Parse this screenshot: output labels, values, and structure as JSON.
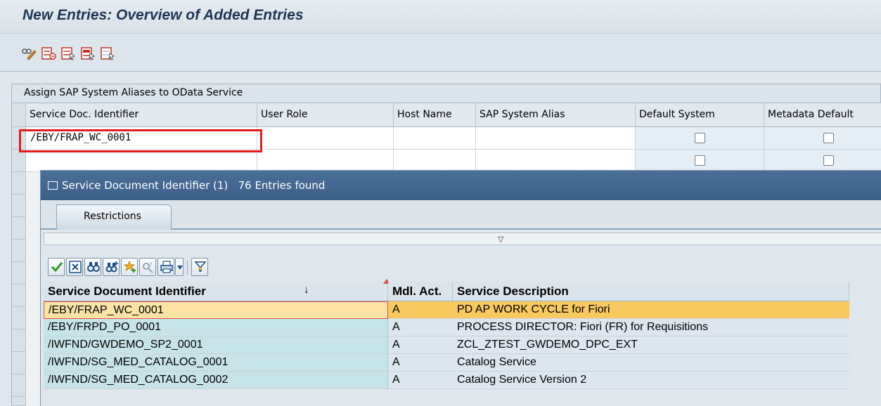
{
  "window": {
    "title": "New Entries: Overview of Added Entries"
  },
  "toolbar": {
    "icons": [
      "display-change-icon",
      "delete-row-icon",
      "select-all-icon",
      "select-block-icon",
      "deselect-all-icon"
    ]
  },
  "table": {
    "caption": "Assign SAP System Aliases to OData Service",
    "columns": [
      "Service Doc. Identifier",
      "User Role",
      "Host Name",
      "SAP System Alias",
      "Default System",
      "Metadata Default"
    ],
    "rows": [
      {
        "service_doc_id": "/EBY/FRAP_WC_0001",
        "user_role": "",
        "host_name": "",
        "system_alias": "",
        "default_system": false,
        "metadata_default": false
      },
      {
        "service_doc_id": "",
        "user_role": "",
        "host_name": "",
        "system_alias": "",
        "default_system": false,
        "metadata_default": false
      }
    ]
  },
  "popup": {
    "title": "Service Document Identifier (1)",
    "entries_found": "76 Entries found",
    "tab_label": "Restrictions",
    "result_columns": [
      "Service Document Identifier",
      "Mdl. Act.",
      "Service Description"
    ],
    "results": [
      {
        "id": "/EBY/FRAP_WC_0001",
        "mdl_act": "A",
        "description": "PD AP WORK CYCLE for Fiori",
        "selected": true
      },
      {
        "id": "/EBY/FRPD_PO_0001",
        "mdl_act": "A",
        "description": "PROCESS DIRECTOR: Fiori (FR) for Requisitions",
        "selected": false
      },
      {
        "id": "/IWFND/GWDEMO_SP2_0001",
        "mdl_act": "A",
        "description": "ZCL_ZTEST_GWDEMO_DPC_EXT",
        "selected": false
      },
      {
        "id": "/IWFND/SG_MED_CATALOG_0001",
        "mdl_act": "A",
        "description": "Catalog Service",
        "selected": false
      },
      {
        "id": "/IWFND/SG_MED_CATALOG_0002",
        "mdl_act": "A",
        "description": "Catalog Service Version 2",
        "selected": false
      }
    ]
  },
  "colors": {
    "title_text": "#1d3656",
    "popup_title_bg": "#3d6089",
    "selected_row": "#f8c95f",
    "highlight_box": "#e41c1c"
  }
}
